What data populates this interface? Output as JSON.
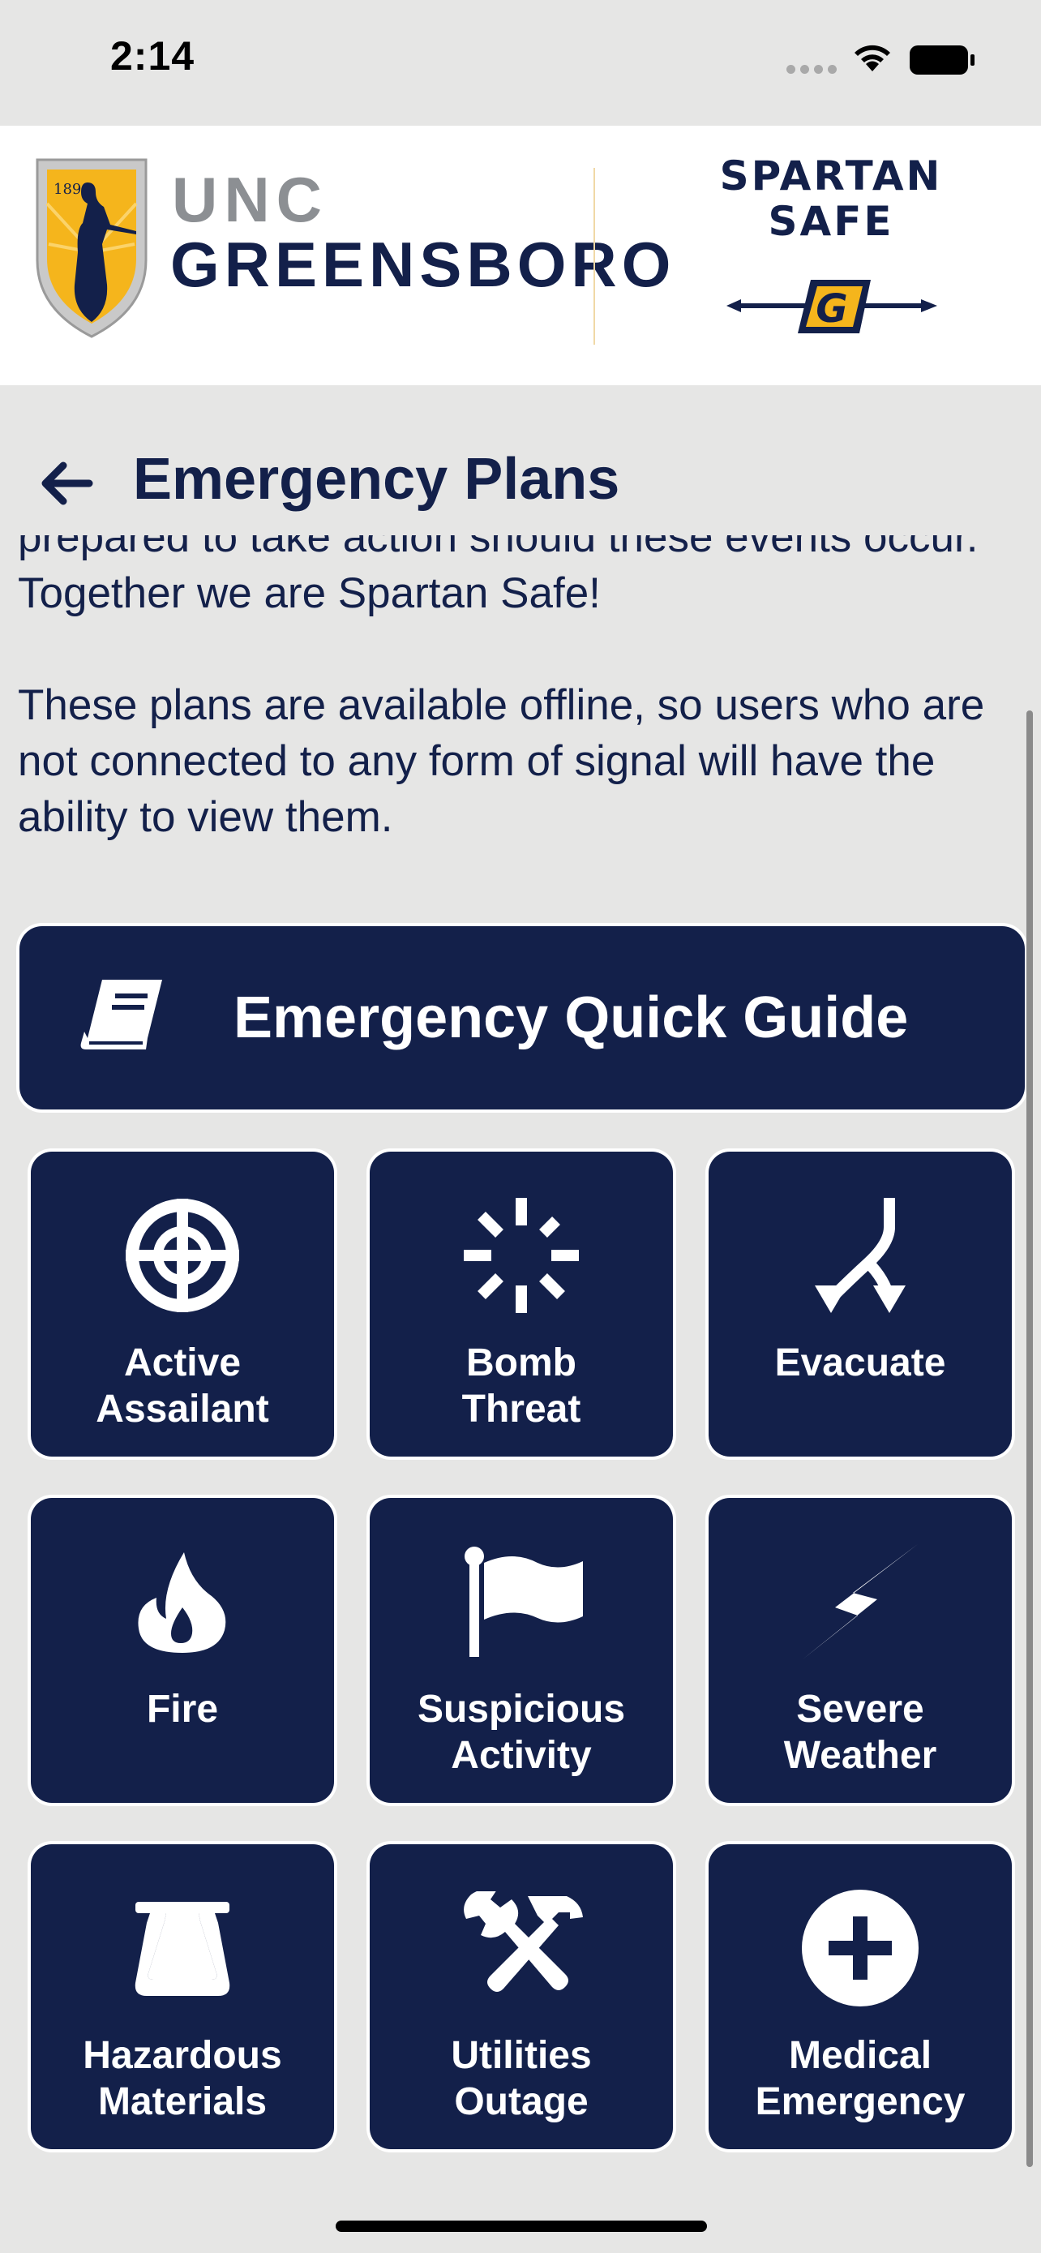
{
  "status_bar": {
    "time": "2:14"
  },
  "header": {
    "logo_year": "1891",
    "unc": "UNC",
    "greensboro": "GREENSBORO",
    "spartan_line1": "SPARTAN",
    "spartan_line2": "SAFE",
    "spear_letter": "G"
  },
  "page": {
    "title": "Emergency Plans"
  },
  "intro": {
    "paragraph1": "prepared to take action should these events occur. Together we are Spartan Safe!",
    "paragraph2": "These plans are available offline, so users who are not connected to any form of signal will have the ability to view them."
  },
  "quick_guide": {
    "label": "Emergency Quick Guide",
    "icon": "book-icon"
  },
  "tiles": [
    {
      "line1": "Active",
      "line2": "Assailant",
      "icon": "crosshair-icon"
    },
    {
      "line1": "Bomb",
      "line2": "Threat",
      "icon": "burst-icon"
    },
    {
      "line1": "Evacuate",
      "line2": "",
      "icon": "split-arrows-icon"
    },
    {
      "line1": "Fire",
      "line2": "",
      "icon": "fire-icon"
    },
    {
      "line1": "Suspicious",
      "line2": "Activity",
      "icon": "flag-icon"
    },
    {
      "line1": "Severe",
      "line2": "Weather",
      "icon": "lightning-icon"
    },
    {
      "line1": "Hazardous",
      "line2": "Materials",
      "icon": "hazard-container-icon"
    },
    {
      "line1": "Utilities",
      "line2": "Outage",
      "icon": "tools-icon"
    },
    {
      "line1": "Medical",
      "line2": "Emergency",
      "icon": "medical-plus-icon"
    }
  ],
  "colors": {
    "navy": "#13204a",
    "gold": "#f5b51c",
    "background": "#e6e6e5"
  }
}
